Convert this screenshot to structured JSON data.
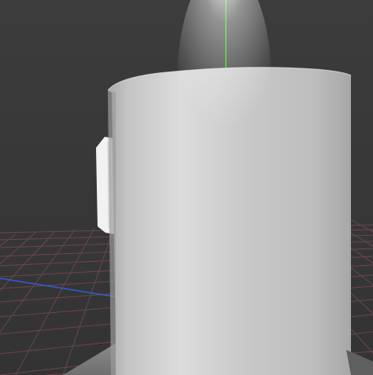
{
  "viewport": {
    "title": "",
    "background_color": "#3b3b3b",
    "grid_color": "#7a4a55",
    "axis_y_color": "#22cc00",
    "axis_x_color": "#2f5fd8",
    "object_color": "#c8c8c8"
  },
  "scene": {
    "objects": [
      {
        "name": "cylinder",
        "type": "cylinder",
        "selected": false
      },
      {
        "name": "handle",
        "type": "mesh",
        "selected": false
      },
      {
        "name": "base-plate",
        "type": "disc",
        "selected": false
      }
    ],
    "gizmo": {
      "up_axis": "Y"
    }
  }
}
